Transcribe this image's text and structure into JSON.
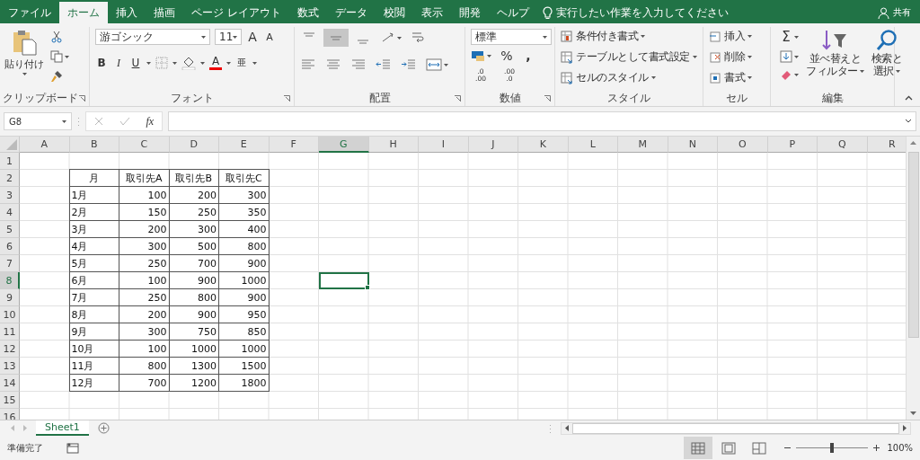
{
  "tabs": [
    {
      "label": "ファイル",
      "selected": false
    },
    {
      "label": "ホーム",
      "selected": true
    },
    {
      "label": "挿入",
      "selected": false
    },
    {
      "label": "描画",
      "selected": false
    },
    {
      "label": "ページ レイアウト",
      "selected": false
    },
    {
      "label": "数式",
      "selected": false
    },
    {
      "label": "データ",
      "selected": false
    },
    {
      "label": "校閲",
      "selected": false
    },
    {
      "label": "表示",
      "selected": false
    },
    {
      "label": "開発",
      "selected": false
    },
    {
      "label": "ヘルプ",
      "selected": false
    }
  ],
  "search": {
    "placeholder": "実行したい作業を入力してください"
  },
  "share": "共有",
  "ribbon": {
    "clipboard": {
      "paste": "貼り付け",
      "label": "クリップボード"
    },
    "font": {
      "font_name": "游ゴシック",
      "font_size": "11",
      "grow": "A",
      "shrink": "A",
      "bold": "B",
      "italic": "I",
      "underline": "U",
      "font_color": "A",
      "furigana": "亜",
      "label": "フォント"
    },
    "alignment": {
      "label": "配置"
    },
    "number": {
      "format": "標準",
      "percent": "%",
      "comma": ",",
      "decimals": [
        {
          "top": ".0",
          "bottom": ".00"
        },
        {
          "top": ".00",
          "bottom": ".0"
        }
      ],
      "label": "数値"
    },
    "styles": {
      "items": [
        "条件付き書式",
        "テーブルとして書式設定",
        "セルのスタイル"
      ],
      "label": "スタイル"
    },
    "cells": {
      "items": [
        "挿入",
        "削除",
        "書式"
      ],
      "label": "セル"
    },
    "editing": {
      "autosum": "Σ",
      "sort": [
        "並べ替えと",
        "フィルター"
      ],
      "find": [
        "検索と",
        "選択"
      ],
      "label": "編集"
    }
  },
  "formula_bar": {
    "name_box": "G8",
    "function_button": "fx"
  },
  "sheet": {
    "columns": [
      {
        "label": "A",
        "selected": false
      },
      {
        "label": "B",
        "selected": false
      },
      {
        "label": "C",
        "selected": false
      },
      {
        "label": "D",
        "selected": false
      },
      {
        "label": "E",
        "selected": false
      },
      {
        "label": "F",
        "selected": false
      },
      {
        "label": "G",
        "selected": true
      },
      {
        "label": "H",
        "selected": false
      },
      {
        "label": "I",
        "selected": false
      },
      {
        "label": "J",
        "selected": false
      },
      {
        "label": "K",
        "selected": false
      },
      {
        "label": "L",
        "selected": false
      },
      {
        "label": "M",
        "selected": false
      },
      {
        "label": "N",
        "selected": false
      },
      {
        "label": "O",
        "selected": false
      },
      {
        "label": "P",
        "selected": false
      },
      {
        "label": "Q",
        "selected": false
      },
      {
        "label": "R",
        "selected": false
      }
    ],
    "rows": [
      {
        "label": "1",
        "selected": false
      },
      {
        "label": "2",
        "selected": false
      },
      {
        "label": "3",
        "selected": false
      },
      {
        "label": "4",
        "selected": false
      },
      {
        "label": "5",
        "selected": false
      },
      {
        "label": "6",
        "selected": false
      },
      {
        "label": "7",
        "selected": false
      },
      {
        "label": "8",
        "selected": true
      },
      {
        "label": "9",
        "selected": false
      },
      {
        "label": "10",
        "selected": false
      },
      {
        "label": "11",
        "selected": false
      },
      {
        "label": "12",
        "selected": false
      },
      {
        "label": "13",
        "selected": false
      },
      {
        "label": "14",
        "selected": false
      },
      {
        "label": "15",
        "selected": false
      },
      {
        "label": "16",
        "selected": false
      }
    ],
    "table": {
      "header": [
        "月",
        "取引先A",
        "取引先B",
        "取引先C"
      ],
      "rows": [
        [
          "1月",
          "100",
          "200",
          "300"
        ],
        [
          "2月",
          "150",
          "250",
          "350"
        ],
        [
          "3月",
          "200",
          "300",
          "400"
        ],
        [
          "4月",
          "300",
          "500",
          "800"
        ],
        [
          "5月",
          "250",
          "700",
          "900"
        ],
        [
          "6月",
          "100",
          "900",
          "1000"
        ],
        [
          "7月",
          "250",
          "800",
          "900"
        ],
        [
          "8月",
          "200",
          "900",
          "950"
        ],
        [
          "9月",
          "300",
          "750",
          "850"
        ],
        [
          "10月",
          "100",
          "1000",
          "1000"
        ],
        [
          "11月",
          "800",
          "1300",
          "1500"
        ],
        [
          "12月",
          "700",
          "1200",
          "1800"
        ]
      ]
    }
  },
  "sheet_tabs": [
    {
      "label": "Sheet1",
      "selected": true
    }
  ],
  "status_bar": {
    "status": "準備完了",
    "views": [
      {
        "kind": "normal",
        "selected": true
      },
      {
        "kind": "page-layout",
        "selected": false
      },
      {
        "kind": "page-break",
        "selected": false
      }
    ],
    "zoom": {
      "level": 0.5
    },
    "zoom_label": "100%"
  }
}
